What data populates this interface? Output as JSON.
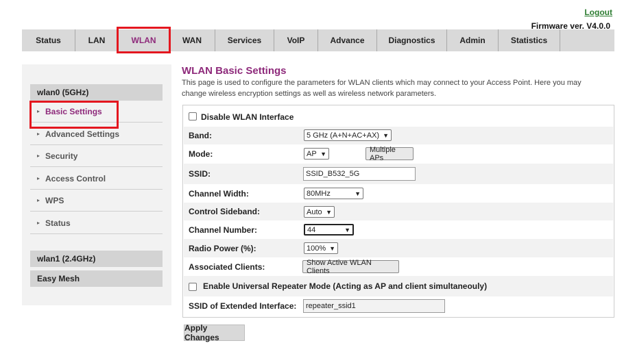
{
  "header": {
    "logout_label": "Logout",
    "firmware": "Firmware ver. V4.0.0"
  },
  "nav": {
    "tabs": [
      {
        "label": "Status"
      },
      {
        "label": "LAN"
      },
      {
        "label": "WLAN",
        "active": true
      },
      {
        "label": "WAN"
      },
      {
        "label": "Services"
      },
      {
        "label": "VoIP"
      },
      {
        "label": "Advance"
      },
      {
        "label": "Diagnostics"
      },
      {
        "label": "Admin"
      },
      {
        "label": "Statistics"
      }
    ]
  },
  "sidebar": {
    "section_wlan0": "wlan0 (5GHz)",
    "items": [
      {
        "label": "Basic Settings",
        "active": true
      },
      {
        "label": "Advanced Settings"
      },
      {
        "label": "Security"
      },
      {
        "label": "Access Control"
      },
      {
        "label": "WPS"
      },
      {
        "label": "Status"
      }
    ],
    "section_wlan1": "wlan1 (2.4GHz)",
    "section_mesh": "Easy Mesh"
  },
  "page": {
    "title": "WLAN Basic Settings",
    "description": "This page is used to configure the parameters for WLAN clients which may connect to your Access Point. Here you may change wireless encryption settings as well as wireless network parameters."
  },
  "form": {
    "disable_wlan_label": "Disable WLAN Interface",
    "disable_wlan_checked": false,
    "band_label": "Band:",
    "band_value": "5 GHz (A+N+AC+AX)",
    "mode_label": "Mode:",
    "mode_value": "AP",
    "multiple_aps_label": "Multiple APs",
    "ssid_label": "SSID:",
    "ssid_value": "SSID_B532_5G",
    "channel_width_label": "Channel Width:",
    "channel_width_value": "80MHz",
    "control_sideband_label": "Control Sideband:",
    "control_sideband_value": "Auto",
    "channel_number_label": "Channel Number:",
    "channel_number_value": "44",
    "radio_power_label": "Radio Power (%):",
    "radio_power_value": "100%",
    "associated_clients_label": "Associated Clients:",
    "show_clients_label": "Show Active WLAN Clients",
    "repeater_label": "Enable Universal Repeater Mode (Acting as AP and client simultaneouly)",
    "repeater_checked": false,
    "ext_ssid_label": "SSID of Extended Interface:",
    "ext_ssid_value": "repeater_ssid1"
  },
  "actions": {
    "apply_label": "Apply Changes"
  },
  "colors": {
    "accent": "#8e2a7b",
    "highlight_border": "#e4171f",
    "nav_bg": "#d9d9d9",
    "logout": "#2e7d32"
  }
}
